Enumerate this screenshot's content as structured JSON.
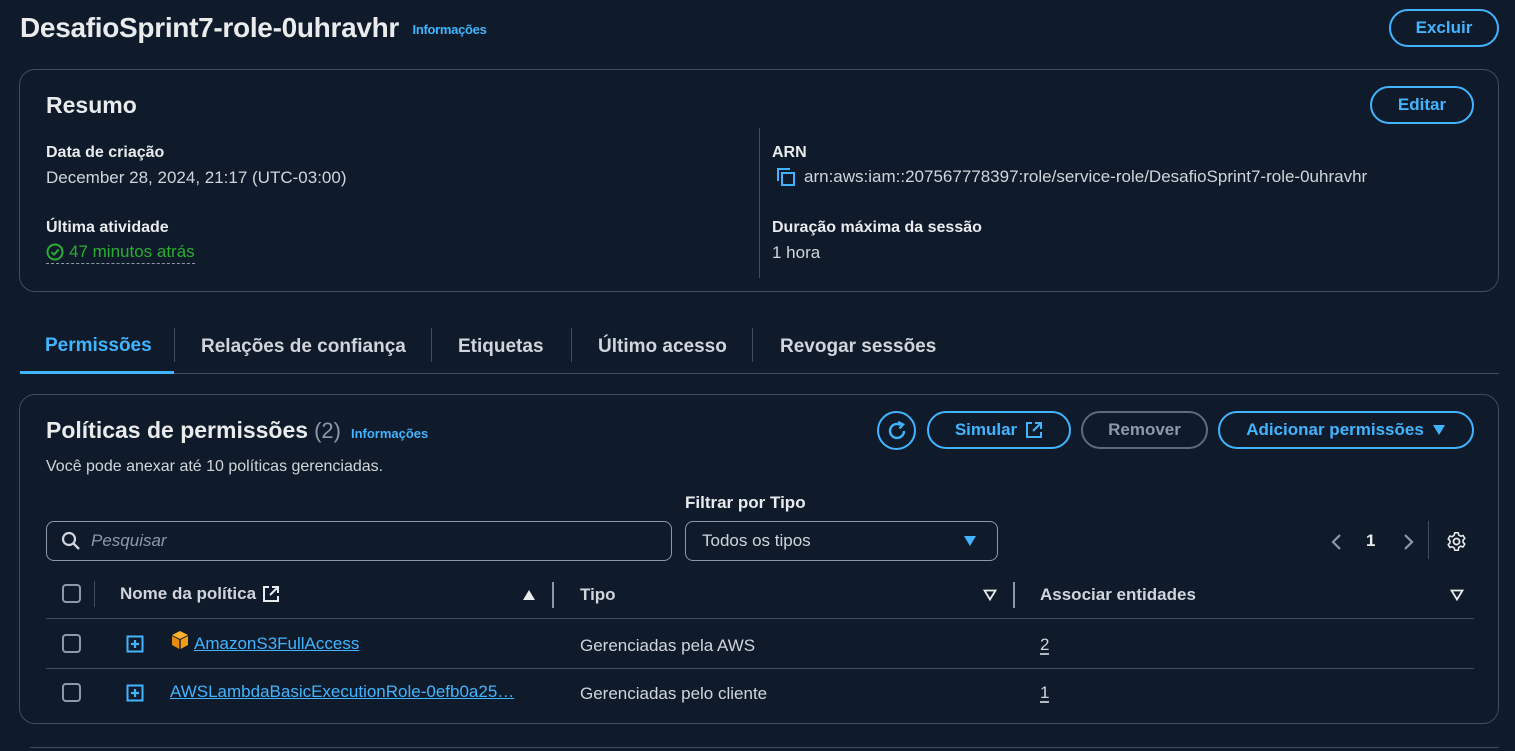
{
  "header": {
    "title": "DesafioSprint7-role-0uhravhr",
    "info": "Informações",
    "delete_label": "Excluir"
  },
  "summary": {
    "title": "Resumo",
    "edit_label": "Editar",
    "created_label": "Data de criação",
    "created_value": "December 28, 2024, 21:17 (UTC-03:00)",
    "last_activity_label": "Última atividade",
    "last_activity_value": "47 minutos atrás",
    "arn_label": "ARN",
    "arn_value": "arn:aws:iam::207567778397:role/service-role/DesafioSprint7-role-0uhravhr",
    "max_session_label": "Duração máxima da sessão",
    "max_session_value": "1 hora"
  },
  "tabs": [
    {
      "label": "Permissões"
    },
    {
      "label": "Relações de confiança"
    },
    {
      "label": "Etiquetas"
    },
    {
      "label": "Último acesso"
    },
    {
      "label": "Revogar sessões"
    }
  ],
  "policies": {
    "title": "Políticas de permissões",
    "count": "(2)",
    "info": "Informações",
    "description": "Você pode anexar até 10 políticas gerenciadas.",
    "simulate_label": "Simular",
    "remove_label": "Remover",
    "add_label": "Adicionar permissões",
    "filter_label": "Filtrar por Tipo",
    "search_placeholder": "Pesquisar",
    "filter_value": "Todos os tipos",
    "page": "1",
    "columns": {
      "name": "Nome da política",
      "type": "Tipo",
      "entities": "Associar entidades"
    },
    "rows": [
      {
        "name": "AmazonS3FullAccess",
        "type": "Gerenciadas pela AWS",
        "entities": "2"
      },
      {
        "name": "AWSLambdaBasicExecutionRole-0efb0a25…",
        "type": "Gerenciadas pelo cliente",
        "entities": "1"
      }
    ]
  },
  "colors": {
    "background": "#0f1b2a",
    "accent": "#42b4ff",
    "success": "#29ad32",
    "border": "#414d5c"
  }
}
